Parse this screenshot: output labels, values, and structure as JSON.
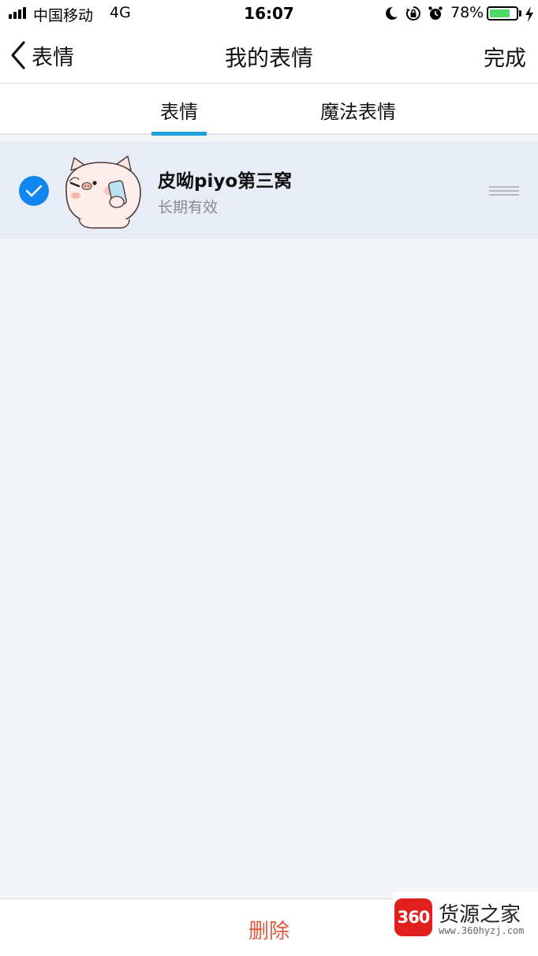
{
  "status_bar": {
    "carrier": "中国移动",
    "network": "4G",
    "time": "16:07",
    "battery_percent": "78%",
    "battery_level": 0.78,
    "icons": [
      "moon-icon",
      "orientation-lock-icon",
      "alarm-icon"
    ]
  },
  "nav": {
    "back_label": "表情",
    "title": "我的表情",
    "done_label": "完成"
  },
  "tabs": [
    {
      "label": "表情",
      "active": true
    },
    {
      "label": "魔法表情",
      "active": false
    }
  ],
  "packs": [
    {
      "title": "皮呦piyo第三窝",
      "subtitle": "长期有效",
      "selected": true,
      "thumbnail": "piyo-pig-phone"
    }
  ],
  "bottom": {
    "delete_label": "删除"
  },
  "watermark": {
    "logo": "360",
    "name": "货源之家",
    "url": "www.360hyzj.com"
  },
  "colors": {
    "accent_blue": "#0f86f0",
    "tab_indicator": "#1fa0d8",
    "delete_red": "#e05a3e",
    "selected_row_bg": "#e7ecf6",
    "page_bg": "#f4f5f9"
  }
}
